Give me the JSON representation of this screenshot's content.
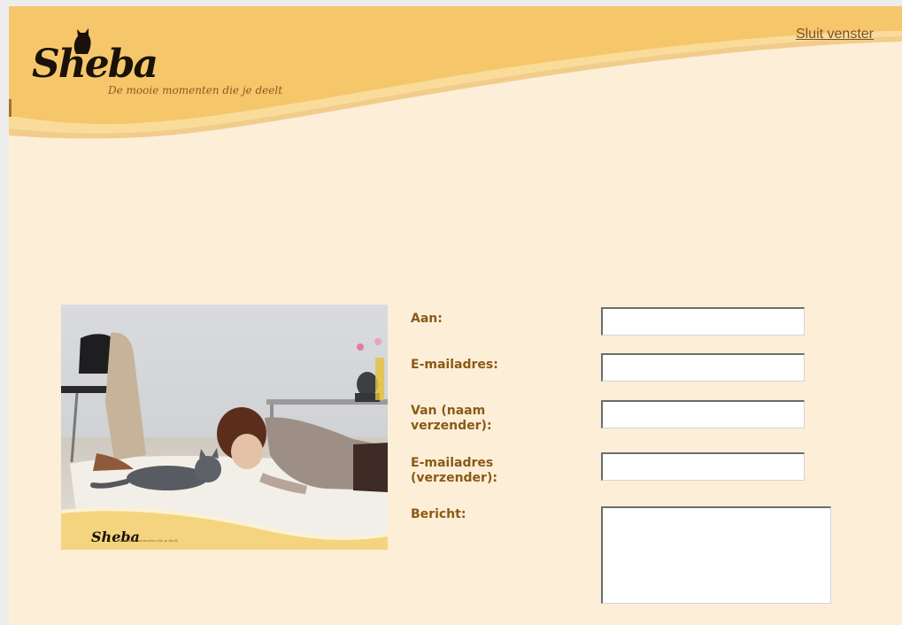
{
  "header": {
    "close_link": "Sluit venster",
    "logo_text": "Sheba",
    "tagline": "De mooie momenten die je deelt"
  },
  "photo": {
    "logo_text": "Sheba",
    "tagline": "De mooie momenten die je deelt"
  },
  "form": {
    "to_label": "Aan:",
    "to_value": "",
    "email_label": "E-mailadres:",
    "email_value": "",
    "from_label": "Van (naam verzender):",
    "from_value": "",
    "sender_email_label": "E-mailadres (verzender):",
    "sender_email_value": "",
    "message_label": "Bericht:",
    "message_value": ""
  },
  "colors": {
    "page_bg": "#fdeed8",
    "header_gold": "#f6c66a",
    "label_brown": "#8a5a14",
    "link_brown": "#7a5228"
  }
}
